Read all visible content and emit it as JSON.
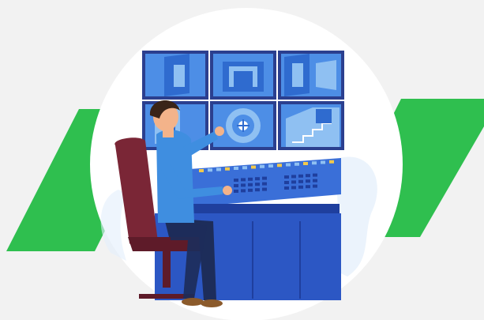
{
  "illustration": {
    "subject": "operator-at-security-monitoring-desk",
    "colors": {
      "background": "#f2f2f2",
      "banner_green": "#2fbf4f",
      "circle": "#ffffff",
      "circle_shadow": "#e3eefb",
      "screen_frame": "#2b3f8f",
      "screen_light": "#8fc0f2",
      "screen_mid": "#4d8ee6",
      "screen_dark": "#2f6bcf",
      "desk_top": "#3a6fd8",
      "desk_front": "#2c57c4",
      "desk_dark": "#1f3f9e",
      "chair": "#7a2636",
      "chair_dark": "#5e1b29",
      "shirt": "#3f8ee0",
      "pants": "#1d2d5a",
      "hair": "#3a2418",
      "skin": "#f3b38a",
      "shoe": "#8b5a2b"
    },
    "icons": {
      "vault": "vault-door-icon",
      "camera_feeds": "cctv-feed-icon"
    }
  }
}
